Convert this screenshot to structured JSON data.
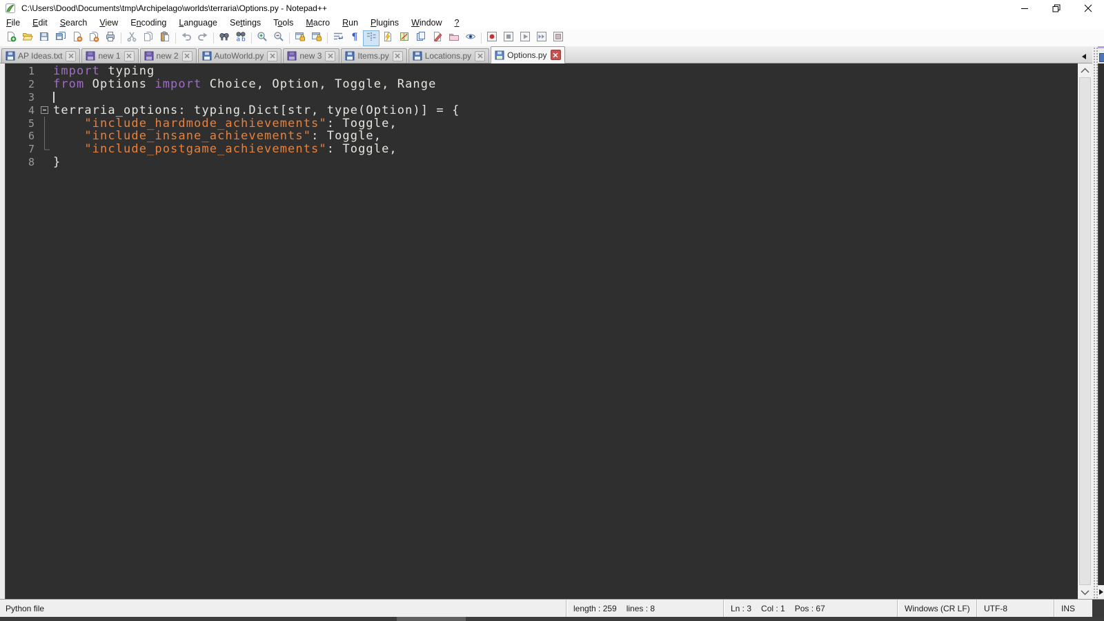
{
  "window": {
    "title": "C:\\Users\\Dood\\Documents\\tmp\\Archipelago\\worlds\\terraria\\Options.py - Notepad++"
  },
  "menu": {
    "items": [
      {
        "label": "File",
        "u": 0
      },
      {
        "label": "Edit",
        "u": 0
      },
      {
        "label": "Search",
        "u": 0
      },
      {
        "label": "View",
        "u": 0
      },
      {
        "label": "Encoding",
        "u": 1
      },
      {
        "label": "Language",
        "u": 0
      },
      {
        "label": "Settings",
        "u": 2
      },
      {
        "label": "Tools",
        "u": 1
      },
      {
        "label": "Macro",
        "u": 0
      },
      {
        "label": "Run",
        "u": 0
      },
      {
        "label": "Plugins",
        "u": 0
      },
      {
        "label": "Window",
        "u": 0
      },
      {
        "label": "?",
        "u": 0
      }
    ]
  },
  "toolbar": {
    "active": "indent-guide",
    "items": [
      "new-file",
      "open",
      "save",
      "save-all",
      "close",
      "close-all",
      "print",
      "|",
      "cut",
      "copy",
      "paste",
      "|",
      "undo",
      "redo",
      "|",
      "find",
      "replace",
      "|",
      "zoom-in",
      "zoom-out",
      "|",
      "sync-scroll-v",
      "sync-scroll-h",
      "|",
      "word-wrap",
      "show-all-chars",
      "indent-guide",
      "function-list",
      "document-map",
      "document-list",
      "edit-marker",
      "project-folder",
      "view-eye",
      "|",
      "macro-record",
      "macro-stop",
      "macro-play",
      "macro-play-multi",
      "macro-save"
    ]
  },
  "tabs": [
    {
      "label": "AP Ideas.txt",
      "kind": "saved",
      "active": false
    },
    {
      "label": "new 1",
      "kind": "new",
      "active": false
    },
    {
      "label": "new 2",
      "kind": "new",
      "active": false
    },
    {
      "label": "AutoWorld.py",
      "kind": "saved",
      "active": false
    },
    {
      "label": "new 3",
      "kind": "new",
      "active": false
    },
    {
      "label": "Items.py",
      "kind": "saved",
      "active": false
    },
    {
      "label": "Locations.py",
      "kind": "saved",
      "active": false
    },
    {
      "label": "Options.py",
      "kind": "active",
      "active": true
    }
  ],
  "editor": {
    "cursor_line": 3,
    "lines": [
      {
        "n": 1,
        "fold": "",
        "tokens": [
          [
            "kw",
            "import"
          ],
          [
            "def",
            " typing"
          ]
        ]
      },
      {
        "n": 2,
        "fold": "",
        "tokens": [
          [
            "kw",
            "from"
          ],
          [
            "def",
            " Options "
          ],
          [
            "kw",
            "import"
          ],
          [
            "def",
            " Choice, Option, Toggle, Range"
          ]
        ]
      },
      {
        "n": 3,
        "fold": "",
        "tokens": []
      },
      {
        "n": 4,
        "fold": "start",
        "tokens": [
          [
            "def",
            "terraria_options: typing.Dict[str, type(Option)] = {"
          ]
        ]
      },
      {
        "n": 5,
        "fold": "mid",
        "tokens": [
          [
            "def",
            "    "
          ],
          [
            "str",
            "\"include_hardmode_achievements\""
          ],
          [
            "def",
            ": Toggle,"
          ]
        ]
      },
      {
        "n": 6,
        "fold": "mid",
        "tokens": [
          [
            "def",
            "    "
          ],
          [
            "str",
            "\"include_insane_achievements\""
          ],
          [
            "def",
            ": Toggle,"
          ]
        ]
      },
      {
        "n": 7,
        "fold": "end",
        "tokens": [
          [
            "def",
            "    "
          ],
          [
            "str",
            "\"include_postgame_achievements\""
          ],
          [
            "def",
            ": Toggle,"
          ]
        ]
      },
      {
        "n": 8,
        "fold": "",
        "tokens": [
          [
            "def",
            "}"
          ]
        ]
      }
    ]
  },
  "status": {
    "doc_type": "Python file",
    "length": "length : 259",
    "lines": "lines : 8",
    "ln": "Ln : 3",
    "col": "Col : 1",
    "pos": "Pos : 67",
    "eol": "Windows (CR LF)",
    "encoding": "UTF-8",
    "mode": "INS"
  },
  "colors": {
    "keyword": "#a06cc8",
    "string": "#e8813c",
    "text": "#e6e6e0",
    "editor_bg": "#2f2f2f",
    "gutter_text": "#9a9a9a",
    "tab_accent": "#b4a2e0",
    "active_close": "#c75050"
  }
}
